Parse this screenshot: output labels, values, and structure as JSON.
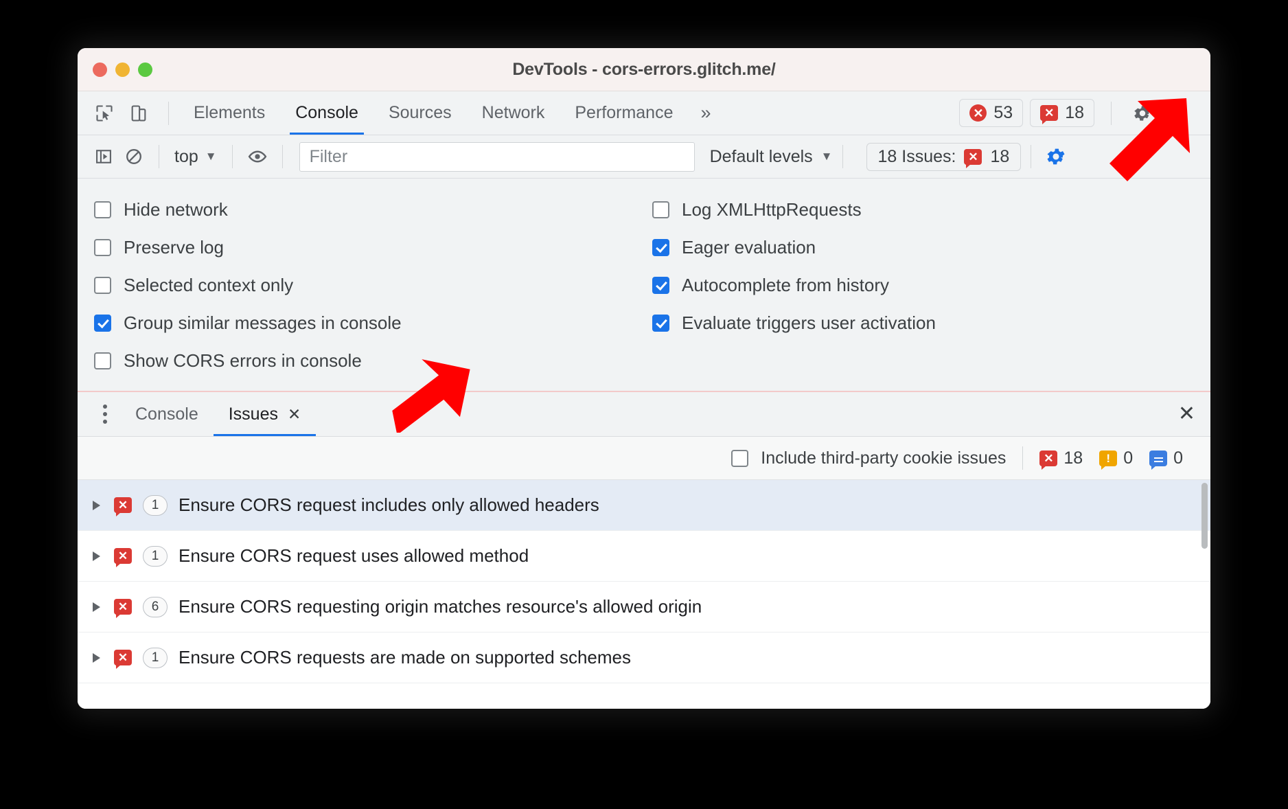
{
  "window": {
    "title": "DevTools - cors-errors.glitch.me/",
    "traffic_lights": [
      "close-red",
      "minimize-yellow",
      "zoom-green"
    ]
  },
  "main_tabs": {
    "left_icons": [
      "inspect-element-icon",
      "device-toolbar-icon"
    ],
    "items": [
      {
        "label": "Elements",
        "active": false
      },
      {
        "label": "Console",
        "active": true
      },
      {
        "label": "Sources",
        "active": false
      },
      {
        "label": "Network",
        "active": false
      },
      {
        "label": "Performance",
        "active": false
      }
    ],
    "more_label": "»",
    "badges": [
      {
        "icon": "circle-x-error-icon",
        "value": "53"
      },
      {
        "icon": "bubble-x-issue-icon",
        "value": "18"
      }
    ],
    "settings_icon": "gear-icon",
    "menu_icon": "kebab-menu-icon"
  },
  "console_toolbar": {
    "sidebar_toggle_icon": "console-sidebar-icon",
    "clear_icon": "clear-console-icon",
    "context_label": "top",
    "eye_icon": "live-expression-eye-icon",
    "filter_placeholder": "Filter",
    "filter_value": "",
    "levels_label": "Default levels",
    "issues_chip_label": "18 Issues:",
    "issues_chip_icon": "bubble-x-issue-icon",
    "issues_chip_count": "18",
    "gear_icon": "gear-icon",
    "gear_color": "#1a73e8"
  },
  "settings_pane": {
    "left_column": [
      {
        "label": "Hide network",
        "checked": false
      },
      {
        "label": "Preserve log",
        "checked": false
      },
      {
        "label": "Selected context only",
        "checked": false
      },
      {
        "label": "Group similar messages in console",
        "checked": true
      },
      {
        "label": "Show CORS errors in console",
        "checked": false
      }
    ],
    "right_column": [
      {
        "label": "Log XMLHttpRequests",
        "checked": false
      },
      {
        "label": "Eager evaluation",
        "checked": true
      },
      {
        "label": "Autocomplete from history",
        "checked": true
      },
      {
        "label": "Evaluate triggers user activation",
        "checked": true
      }
    ]
  },
  "drawer": {
    "menu_icon": "kebab-menu-icon",
    "tabs": [
      {
        "label": "Console",
        "active": false,
        "closable": false
      },
      {
        "label": "Issues",
        "active": true,
        "closable": true,
        "close_glyph": "✕"
      }
    ],
    "close_glyph": "✕",
    "toolbar": {
      "third_party_label": "Include third-party cookie issues",
      "third_party_checked": false,
      "counts": [
        {
          "icon": "bubble-x-error-icon",
          "value": "18",
          "color": "#db3a34"
        },
        {
          "icon": "bubble-warning-icon",
          "value": "0",
          "color": "#f0a500"
        },
        {
          "icon": "bubble-info-icon",
          "value": "0",
          "color": "#3b7de0"
        }
      ]
    },
    "issues": [
      {
        "expander": "collapsed-triangle-icon",
        "icon": "bubble-x-error-icon",
        "count": "1",
        "title": "Ensure CORS request includes only allowed headers",
        "selected": true
      },
      {
        "expander": "collapsed-triangle-icon",
        "icon": "bubble-x-error-icon",
        "count": "1",
        "title": "Ensure CORS request uses allowed method",
        "selected": false
      },
      {
        "expander": "collapsed-triangle-icon",
        "icon": "bubble-x-error-icon",
        "count": "6",
        "title": "Ensure CORS requesting origin matches resource's allowed origin",
        "selected": false
      },
      {
        "expander": "collapsed-triangle-icon",
        "icon": "bubble-x-error-icon",
        "count": "1",
        "title": "Ensure CORS requests are made on supported schemes",
        "selected": false
      }
    ]
  },
  "annotations": {
    "arrow_color": "#ff0000",
    "arrows": [
      {
        "name": "arrow-pointing-to-console-settings-gear"
      },
      {
        "name": "arrow-pointing-to-show-cors-errors-checkbox"
      }
    ]
  },
  "glyphs": {
    "x": "✕",
    "caret_down": "▼",
    "chevrons": "»"
  }
}
